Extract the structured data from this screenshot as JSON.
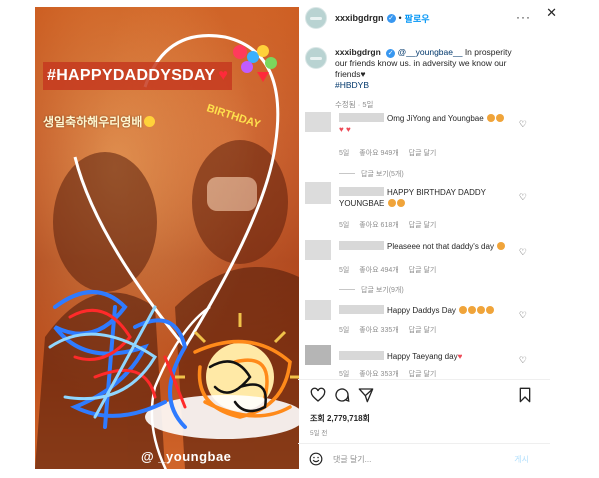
{
  "media": {
    "hashtag_text": "#HAPPYDADDYSDAY",
    "korean_text": "생일축하해우리영배",
    "sticker_handle": "@ _youngbae",
    "balloon_text": "BIRTHDAY"
  },
  "header": {
    "username": "xxxibgdrgn",
    "follow_label": "팔로우",
    "more_label": "···",
    "close_label": "✕"
  },
  "caption": {
    "username": "xxxibgdrgn",
    "mention": "@__youngbae__",
    "text": " In prosperity our friends know us. in adversity we know our friends",
    "hashtag": "#HBDYB",
    "meta": "수정됨 · 5일"
  },
  "comments": [
    {
      "text": "Omg JiYong and Youngbae",
      "date": "5일",
      "likes": "좋아요 949개",
      "reply": "답글 달기",
      "replies": "답글 보기(5개)"
    },
    {
      "text": "HAPPY BIRTHDAY DADDY YOUNGBAE",
      "date": "5일",
      "likes": "좋아요 618개",
      "reply": "답글 달기",
      "replies": ""
    },
    {
      "text": "Pleaseee not that daddy's day",
      "date": "5일",
      "likes": "좋아요 494개",
      "reply": "답글 달기",
      "replies": "답글 보기(9개)"
    },
    {
      "text": "Happy Daddys Day",
      "date": "5일",
      "likes": "좋아요 335개",
      "reply": "답글 달기",
      "replies": ""
    },
    {
      "text": "Happy Taeyang day",
      "date": "5일",
      "likes": "좋아요 353개",
      "reply": "답글 달기",
      "replies": ""
    }
  ],
  "stats": {
    "views": "조회 2,779,718회",
    "time_ago": "5일 전"
  },
  "composer": {
    "placeholder": "댓글 달기...",
    "post_label": "게시"
  },
  "colors": {
    "accent": "#0095f6",
    "verified": "#3897f0",
    "muted": "#8e8e8e",
    "like_heart": "#ed4956"
  }
}
